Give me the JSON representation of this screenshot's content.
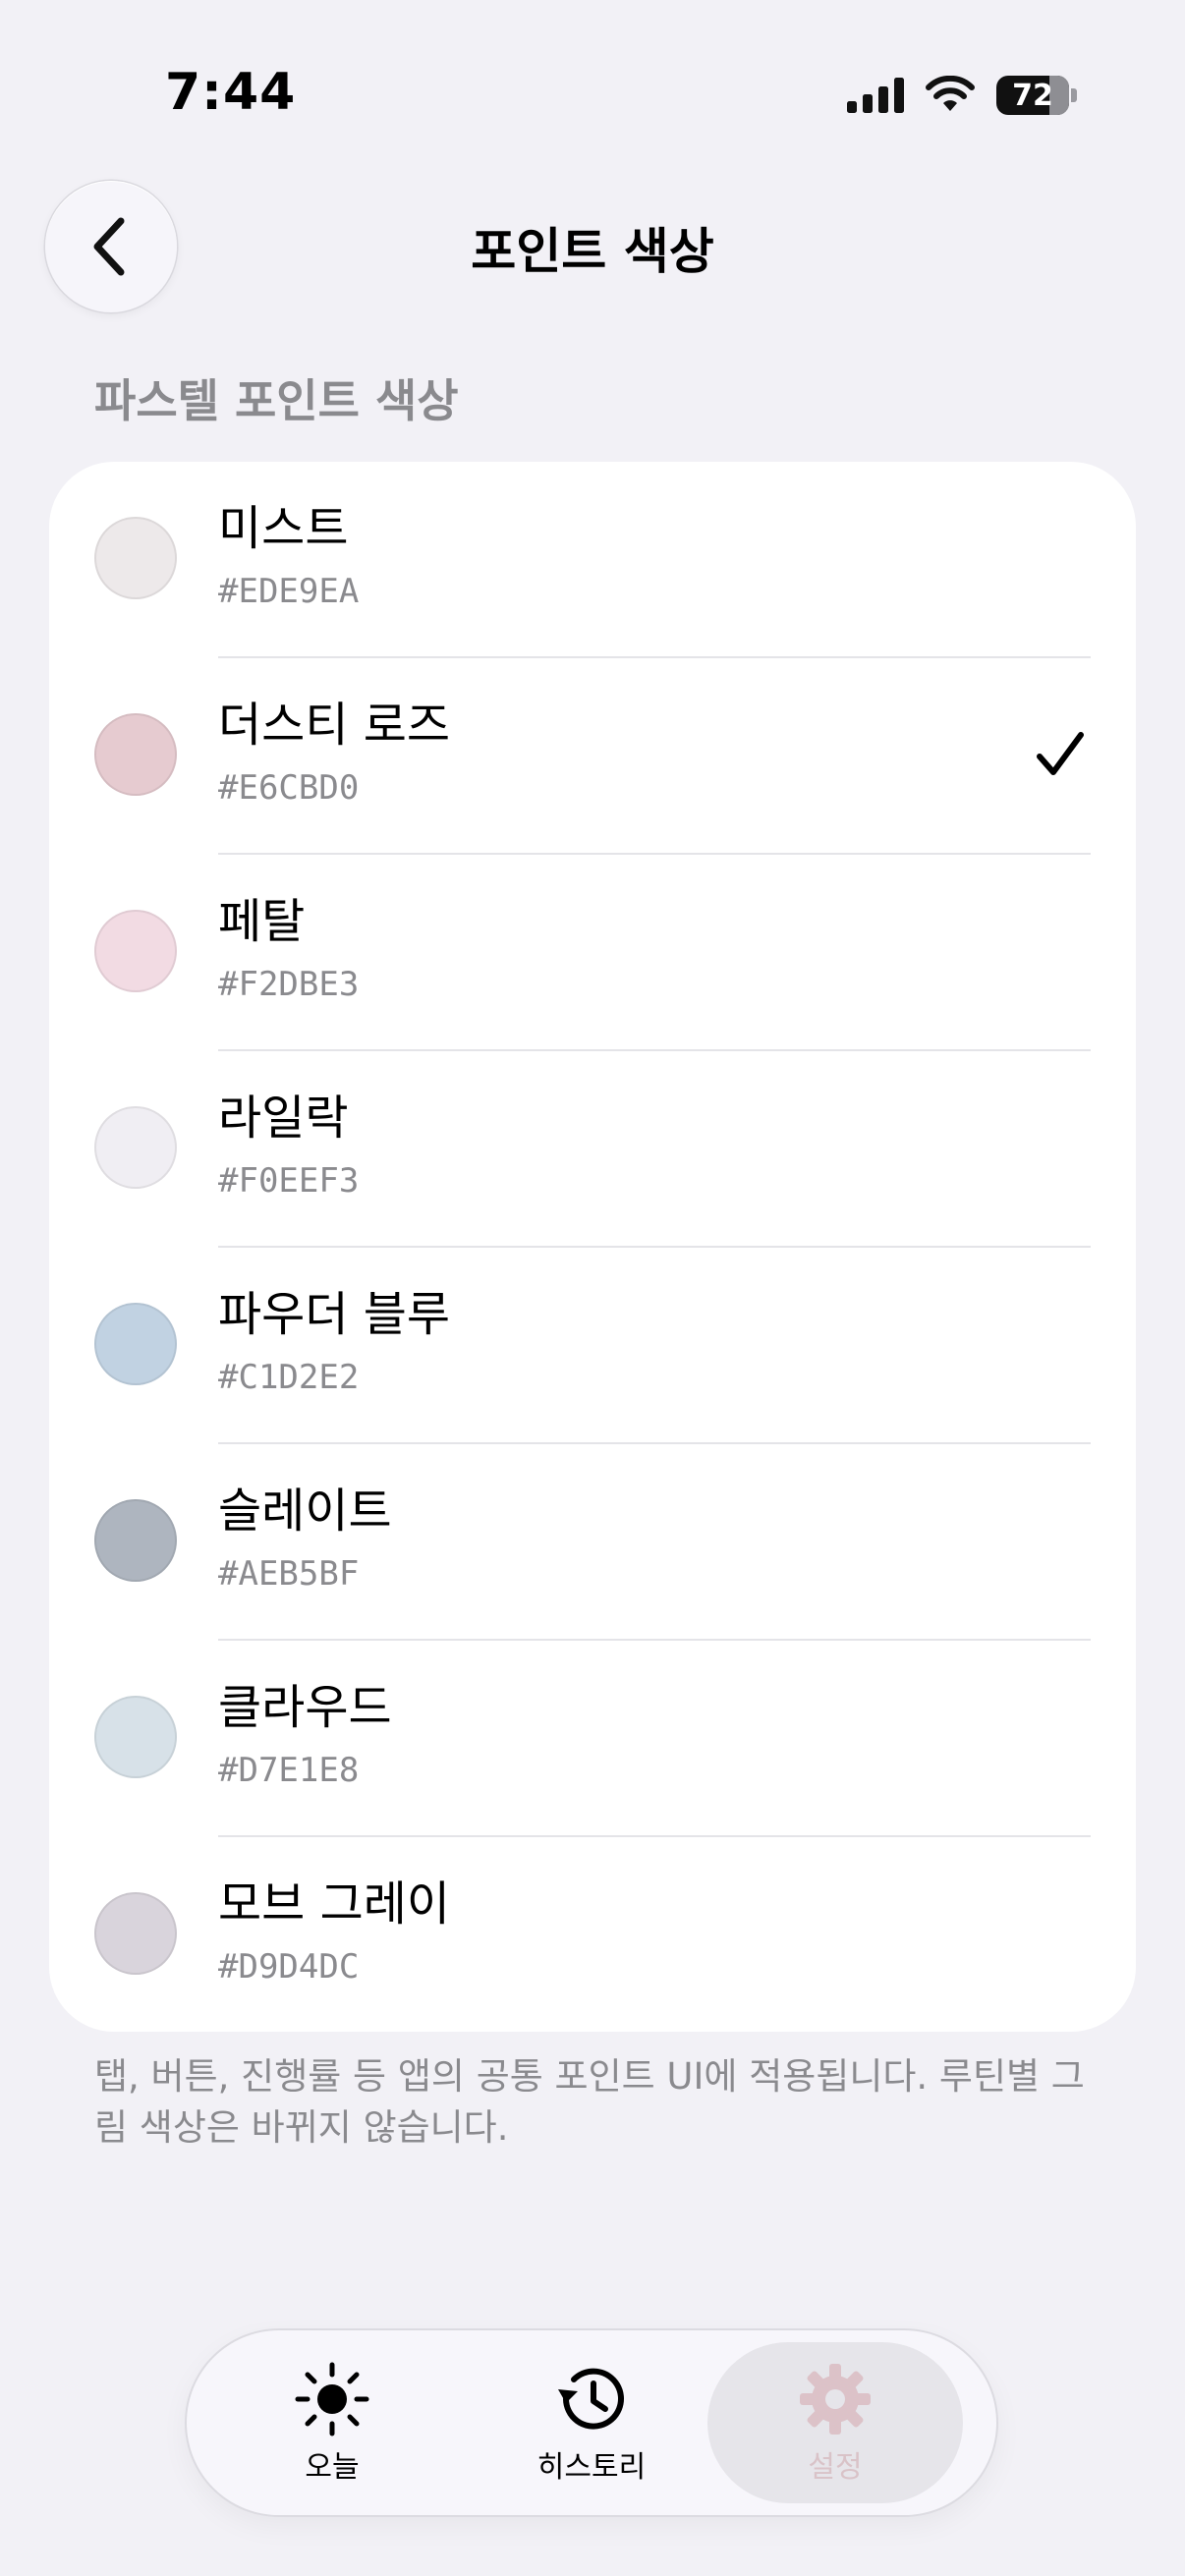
{
  "status_bar": {
    "time": "7:44",
    "battery": "72"
  },
  "header": {
    "title": "포인트 색상",
    "back_icon": "chevron-left-icon"
  },
  "section": {
    "label": "파스텔 포인트 색상"
  },
  "colors": [
    {
      "name": "미스트",
      "hex": "#EDE9EA",
      "selected": false
    },
    {
      "name": "더스티 로즈",
      "hex": "#E6CBD0",
      "selected": true
    },
    {
      "name": "페탈",
      "hex": "#F2DBE3",
      "selected": false
    },
    {
      "name": "라일락",
      "hex": "#F0EEF3",
      "selected": false
    },
    {
      "name": "파우더 블루",
      "hex": "#C1D2E2",
      "selected": false
    },
    {
      "name": "슬레이트",
      "hex": "#AEB5BF",
      "selected": false
    },
    {
      "name": "클라우드",
      "hex": "#D7E1E8",
      "selected": false
    },
    {
      "name": "모브 그레이",
      "hex": "#D9D4DC",
      "selected": false
    }
  ],
  "footnote": "탭, 버튼, 진행률 등 앱의 공통 포인트 UI에 적용됩니다. 루틴별 그림 색상은 바뀌지 않습니다.",
  "tabbar": {
    "tabs": [
      {
        "label": "오늘",
        "icon": "sun-icon",
        "active": false
      },
      {
        "label": "히스토리",
        "icon": "history-icon",
        "active": false
      },
      {
        "label": "설정",
        "icon": "gear-icon",
        "active": true
      }
    ],
    "accent_color": "#E6CBD0"
  }
}
